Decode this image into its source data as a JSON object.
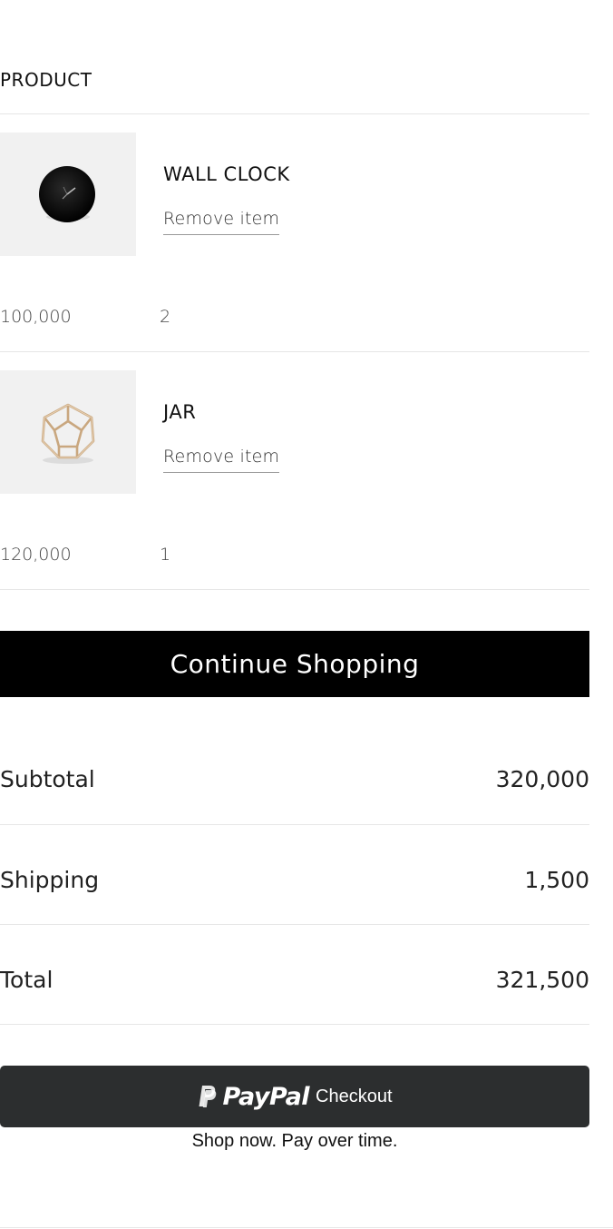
{
  "cart": {
    "column_header": "PRODUCT",
    "items": [
      {
        "name": "WALL CLOCK",
        "remove_label": "Remove item",
        "price": "100,000",
        "quantity": "2",
        "image_icon": "wall-clock-image"
      },
      {
        "name": "JAR",
        "remove_label": "Remove item",
        "price": "120,000",
        "quantity": "1",
        "image_icon": "geometric-jar-image"
      }
    ],
    "continue_label": "Continue Shopping"
  },
  "summary": {
    "subtotal_label": "Subtotal",
    "subtotal_value": "320,000",
    "shipping_label": "Shipping",
    "shipping_value": "1,500",
    "total_label": "Total",
    "total_value": "321,500"
  },
  "paypal": {
    "brand": "PayPal",
    "checkout_label": "Checkout",
    "tagline": "Shop now. Pay over time.",
    "button_color": "#2c2e2f"
  }
}
